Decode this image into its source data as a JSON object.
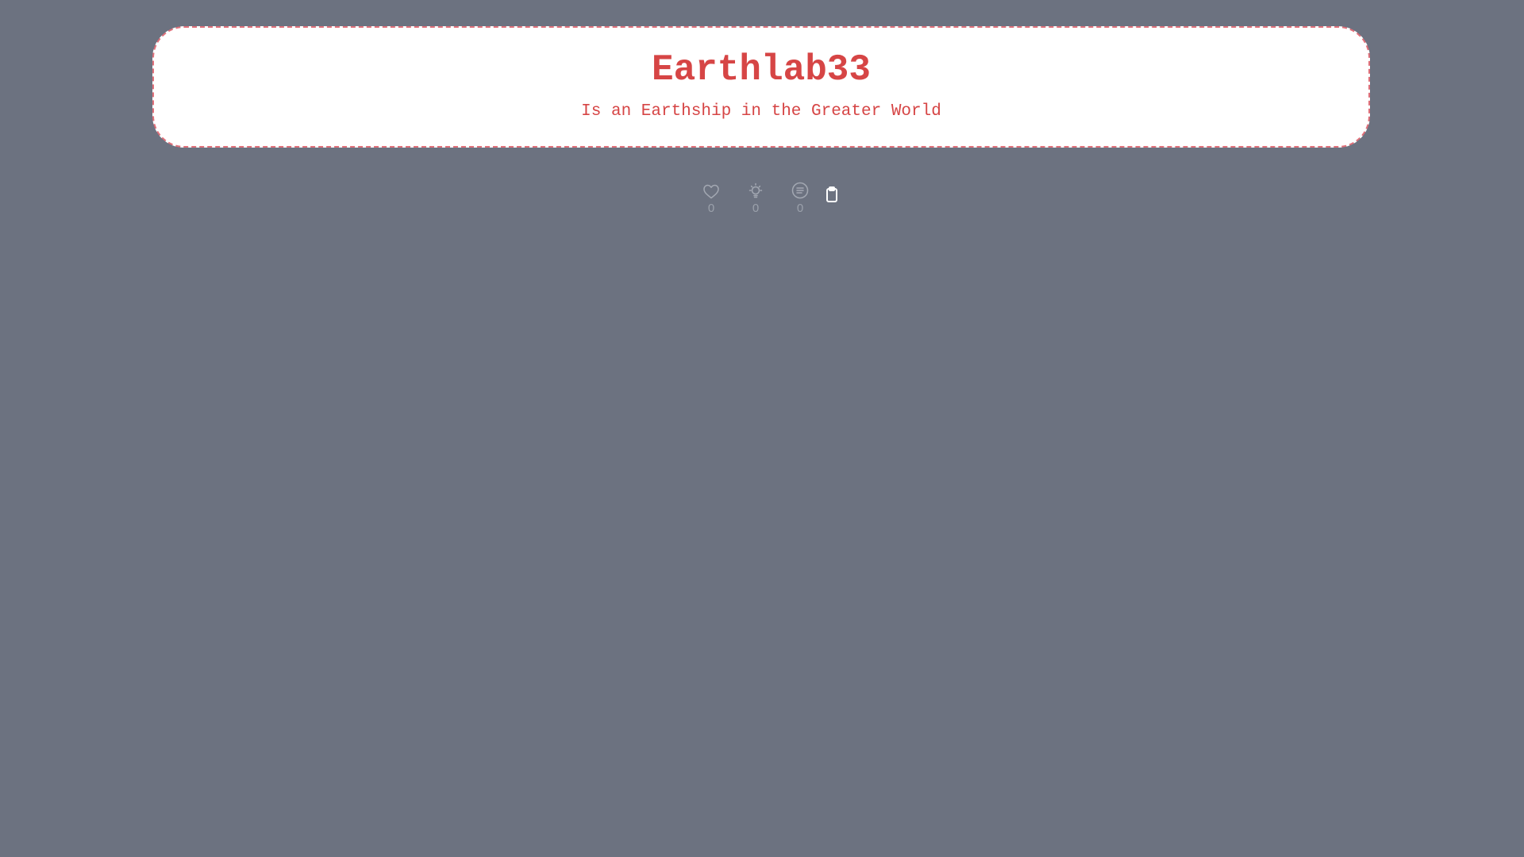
{
  "header": {
    "title": "Earthlab33",
    "subtitle": "Is an Earthship in the Greater World"
  },
  "actions": {
    "like": {
      "icon": "heart-icon",
      "count": "0"
    },
    "idea": {
      "icon": "lightbulb-icon",
      "count": "0"
    },
    "comment": {
      "icon": "list-circle-icon",
      "count": "0"
    },
    "copy": {
      "icon": "clipboard-icon"
    }
  },
  "colors": {
    "background": "#6c7280",
    "card": "#ffffff",
    "accent": "#d64545",
    "muted_icon": "#a3a8b2",
    "clipboard_icon": "#ffffff"
  }
}
